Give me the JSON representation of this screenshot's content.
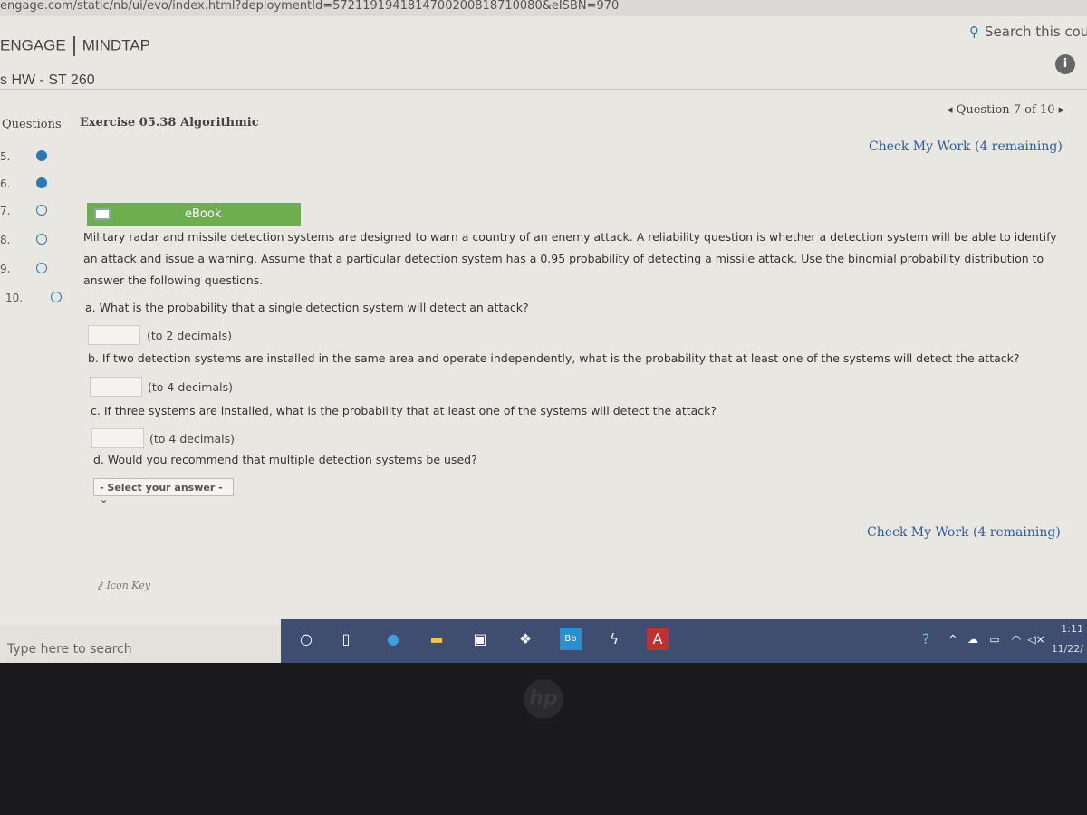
{
  "browser": {
    "url": "engage.com/static/nb/ui/evo/index.html?deploymentId=5721191941814700200818710080&eISBN=970"
  },
  "header": {
    "brand_left": "ENGAGE",
    "brand_right": "MINDTAP",
    "search": "Search this course",
    "course": "s HW - ST 260"
  },
  "toolbar": {
    "questions_label": "Questions",
    "exercise_title": "Exercise 05.38 Algorithmic",
    "question_nav": "Question 7 of 10",
    "check_top": "Check My Work (4 remaining)",
    "check_bottom": "Check My Work (4 remaining)"
  },
  "sidebar": {
    "items": [
      {
        "num": "5.",
        "status": "answered"
      },
      {
        "num": "6.",
        "status": "answered"
      },
      {
        "num": "7.",
        "status": "unanswered"
      },
      {
        "num": "8.",
        "status": "unanswered"
      },
      {
        "num": "9.",
        "status": "unanswered"
      },
      {
        "num": "10.",
        "status": "unanswered"
      }
    ]
  },
  "ebook_label": "eBook",
  "problem": "Military radar and missile detection systems are designed to warn a country of an enemy attack. A reliability question is whether a detection system will be able to identify an attack and issue a warning. Assume that a particular detection system has a 0.95 probability of detecting a missile attack. Use the binomial probability distribution to answer the following questions.",
  "parts": {
    "a": {
      "q": "a. What is the probability that a single detection system will detect an attack?",
      "hint": "(to 2 decimals)",
      "value": ""
    },
    "b": {
      "q": "b. If two detection systems are installed in the same area and operate independently, what is the probability that at least one of the systems will detect the attack?",
      "hint": "(to 4 decimals)",
      "value": ""
    },
    "c": {
      "q": "c. If three systems are installed, what is the probability that at least one of the systems will detect the attack?",
      "hint": "(to 4 decimals)",
      "value": ""
    },
    "d": {
      "q": "d. Would you recommend that multiple detection systems be used?",
      "select": "- Select your answer -"
    }
  },
  "icon_key": "Icon Key",
  "taskbar": {
    "search_placeholder": "Type here to search",
    "time": "1:11",
    "date": "11/22/"
  },
  "colors": {
    "accent": "#2a7ab8",
    "ebook": "#6fae4e",
    "taskbar": "#3e4d70"
  }
}
